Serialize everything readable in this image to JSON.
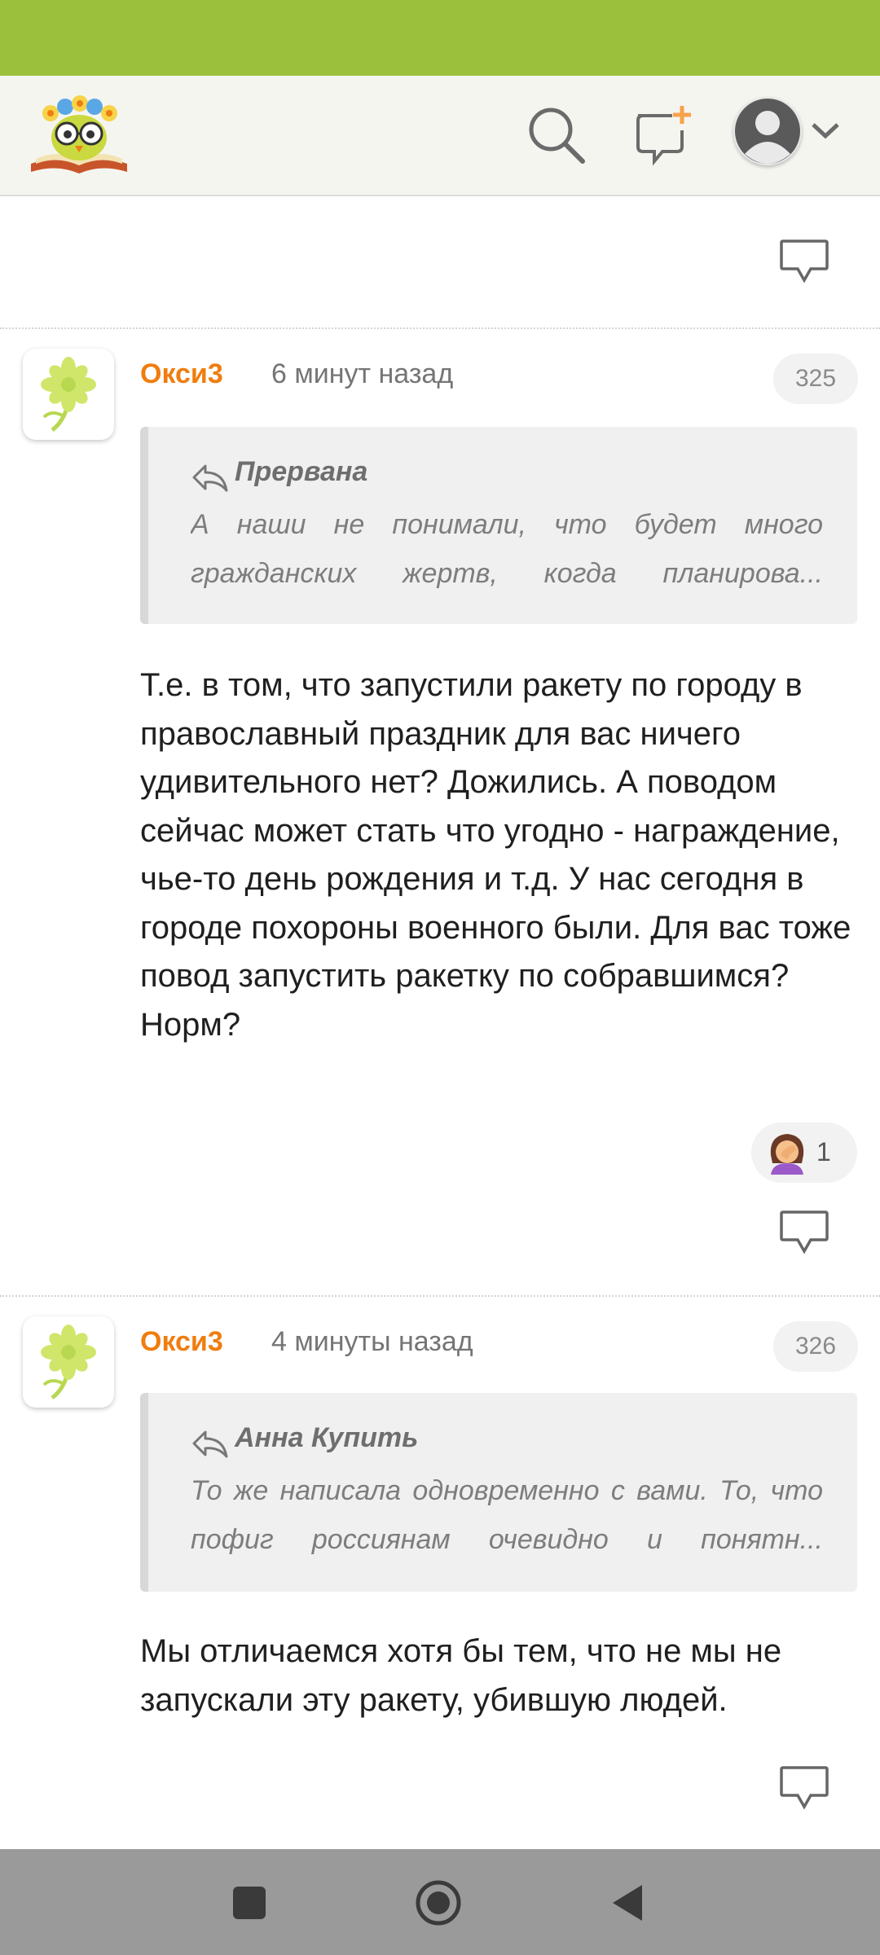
{
  "colors": {
    "status_bar": "#9bc13c",
    "author": "#ef7d0f",
    "nav_bar": "#9a9a9a",
    "accent": "#f7a24b"
  },
  "header": {
    "logo": "owl-book-logo",
    "icons": [
      "search-icon",
      "new-message-icon",
      "user-avatar-icon",
      "chevron-down-icon"
    ]
  },
  "comments": [
    {
      "author": "Окси3",
      "time": "6 минут назад",
      "number": "325",
      "quote_author": "Прервана",
      "quote_text": "А наши не понимали, что будет много гражданских жертв, когда планирова...",
      "body": "Т.е. в том, что запустили ракету по городу в православный праздник для вас ничего удивительного нет? Дожились. А поводом сейчас может стать что угодно - награждение, чье-то день рождения и т.д. У нас сегодня в городе похороны военного были. Для вас тоже повод запустить ракетку по собравшимся? Норм?",
      "reaction": {
        "icon": "facepalm-emoji",
        "count": "1"
      }
    },
    {
      "author": "Окси3",
      "time": "4 минуты назад",
      "number": "326",
      "quote_author": "Анна Купить",
      "quote_text": "То же написала одновременно с вами. То, что пофиг россиянам очевидно и понятн...",
      "body": "Мы отличаемся хотя бы тем, что не мы не запускали эту ракету, убившую людей."
    }
  ],
  "nav": {
    "icons": [
      "recent-apps-icon",
      "home-icon",
      "back-icon"
    ]
  }
}
